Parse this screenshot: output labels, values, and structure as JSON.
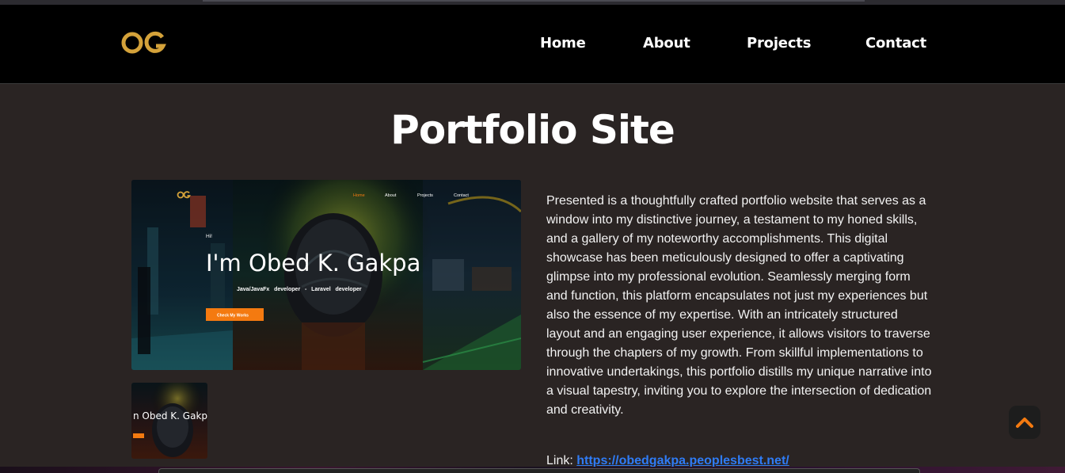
{
  "nav": {
    "logo_text": "OG",
    "links": [
      {
        "label": "Home"
      },
      {
        "label": "About"
      },
      {
        "label": "Projects"
      },
      {
        "label": "Contact"
      }
    ]
  },
  "page": {
    "title": "Portfolio Site"
  },
  "preview": {
    "nav_links": [
      "Home",
      "About",
      "Projects",
      "Contact"
    ],
    "greeting": "Hi!",
    "headline": "I'm Obed K. Gakpa",
    "subline": "Java/JavaFx   developer   -   Laravel   developer",
    "cta": "Check My Works",
    "thumb_headline": "n Obed K. Gakpa"
  },
  "description": "Presented is a thoughtfully crafted portfolio website that serves as a window into my distinctive journey, a testament to my honed skills, and a gallery of my noteworthy accomplishments. This digital showcase has been meticulously designed to offer a captivating glimpse into my professional evolution. Seamlessly merging form and function, this platform encapsulates not just my experiences but also the essence of my expertise. With an intricately structured layout and an engaging user experience, it allows visitors to traverse through the chapters of my growth. From skillful implementations to innovative undertakings, this portfolio distills my unique narrative into a visual tapestry, inviting you to explore the intersection of dedication and creativity.",
  "link": {
    "label": "Link:",
    "url": "https://obedgakpa.peoplesbest.net/"
  },
  "icons": {
    "scroll_top": "chevron-up-icon"
  },
  "colors": {
    "accent": "#f47a10",
    "logo": "#d4a23a",
    "link": "#2f7cf6",
    "background": "#2a2423",
    "navbar": "#000000"
  }
}
